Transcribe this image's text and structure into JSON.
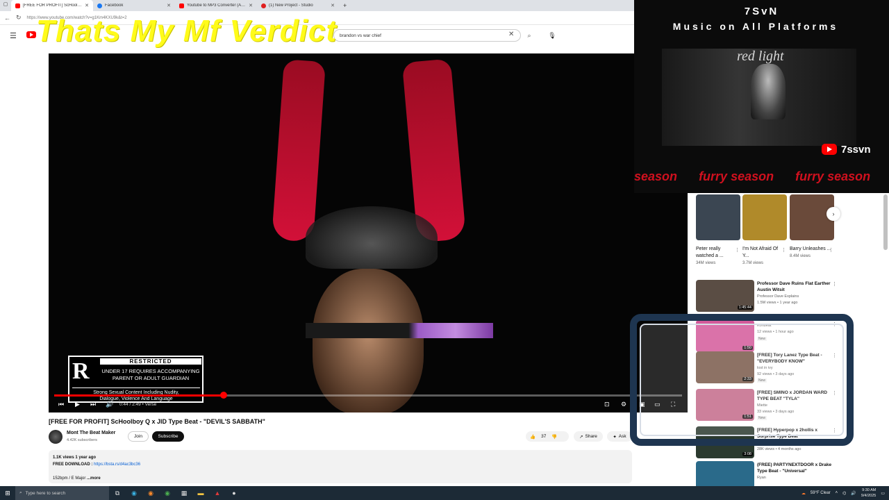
{
  "browser": {
    "tabs": [
      {
        "label": "[FREE FOR PROFIT] ScHoolboy Q",
        "color": "#ff0000",
        "active": true
      },
      {
        "label": "Facebook",
        "color": "#1877f2",
        "active": false
      },
      {
        "label": "Youtube to MP3 Converter (Ad-F",
        "color": "#ff0000",
        "active": false
      },
      {
        "label": "(1) New Project - Studio",
        "color": "#e02020",
        "active": false
      }
    ],
    "new_tab": "+",
    "url": "https://www.youtube.com/watch?v=g1Km4KXU9k&t=2"
  },
  "youtube": {
    "search_value": "brandon vs war chief",
    "search_icon": "search-icon",
    "mic_icon": "mic-icon"
  },
  "overlay_text": {
    "verdict": "Thats My Mf Verdict",
    "stream_title": "7SvN",
    "stream_sub": "Music on All Platforms",
    "sign": "red light",
    "handle": "7ssvn",
    "marquee": [
      "season",
      "furry season",
      "furry season"
    ]
  },
  "video": {
    "rating": {
      "letter": "R",
      "title": "RESTRICTED",
      "line1": "UNDER 17 REQUIRES ACCOMPANYING",
      "line2": "PARENT OR ADULT GUARDIAN",
      "line3": "Strong Sexual Content Including Nudity,",
      "line4": "Dialogue, Violence And Language"
    },
    "time": "0:44 / 2:49 • Verse",
    "progress": 0.27
  },
  "watch": {
    "title": "[FREE FOR PROFIT] ScHoolboy Q x JID Type Beat - \"DEVIL'S SABBATH\"",
    "channel": "Mont The Beat Maker",
    "subscribers": "4.42K subscribers",
    "join": "Join",
    "subscribe": "Subscribe",
    "likes": "37",
    "share": "Share",
    "ask": "Ask",
    "desc_stats": "1.1K views  1 year ago",
    "desc_download_label": "FREE DOWNLOAD :",
    "desc_link": "https://bsta.rs/d4ac3bc36",
    "desc_line2": "152bpm / E Major",
    "desc_more": "...more"
  },
  "shorts": [
    {
      "title": "Peter really watched a ...",
      "views": "34M views",
      "color": "#3b4652"
    },
    {
      "title": "I'm Not Afraid Of Y...",
      "views": "3.7M views",
      "color": "#b08a2a"
    },
    {
      "title": "Barry Unleashes ...",
      "views": "8.4M views",
      "color": "#6a4a3a"
    }
  ],
  "recommendations": [
    {
      "title": "Professor Dave Ruins Flat Earther Austin Witsit",
      "channel": "Professor Dave Explains",
      "meta": "1.5M views • 1 year ago",
      "duration": "1:45:44",
      "badge": "",
      "color": "#5a4d44"
    },
    {
      "title": "",
      "channel": "Konbeat",
      "meta": "12 views • 1 hour ago",
      "duration": "1:50",
      "badge": "New",
      "color": "#d45a9a"
    },
    {
      "title": "[FREE] Tory Lanez Type Beat - \"EVERYBODY KNOW\"",
      "channel": "lost in ivy",
      "meta": "92 views • 3 days ago",
      "duration": "2:33",
      "badge": "New",
      "color": "#7a5a4a"
    },
    {
      "title": "[FREE] SMINO x JORDAN WARD TYPE BEAT \"TYLA\"",
      "channel": "Miette",
      "meta": "33 views • 3 days ago",
      "duration": "1:51",
      "badge": "New",
      "color": "#c46a8a"
    },
    {
      "title": "[FREE] Hyperpop x 2hollis x Surprise Type Beat",
      "channel": "",
      "meta": "28K views • 4 months ago",
      "duration": "3:08",
      "badge": "",
      "color": "#2b3a2f"
    },
    {
      "title": "(FREE) PARTYNEXTDOOR x Drake Type Beat - \"Universal\"",
      "channel": "Ryan",
      "meta": "",
      "duration": "",
      "badge": "",
      "color": "#2a6a8a"
    }
  ],
  "taskbar": {
    "search_placeholder": "Type here to search",
    "weather": "59°F  Clear",
    "time": "9:30 AM",
    "date": "9/4/2025"
  }
}
